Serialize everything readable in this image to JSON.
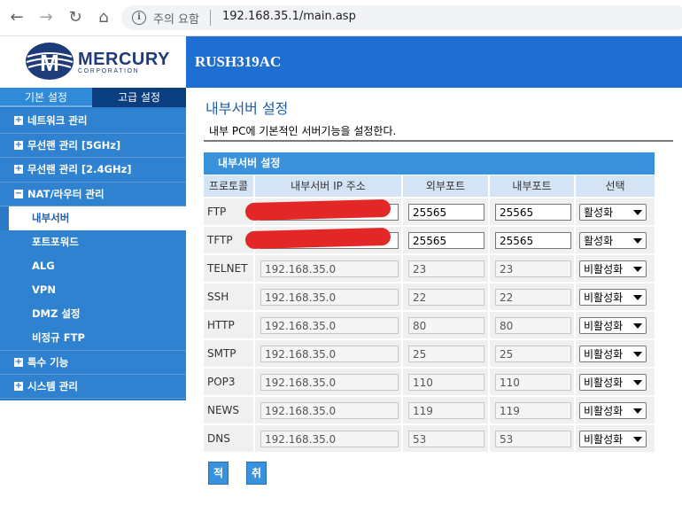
{
  "browser": {
    "security_text": "주의 요함",
    "url": "192.168.35.1/main.asp"
  },
  "header": {
    "logo_name": "MERCURY",
    "logo_sub": "CORPORATION",
    "model": "RUSH319AC",
    "banner_color": "#1f6fd2"
  },
  "sidebar": {
    "tabs": [
      "기본 설정",
      "고급 설정"
    ],
    "items": [
      {
        "label": "네트워크 관리",
        "icon": "plus-icon"
      },
      {
        "label": "무선랜 관리 [5GHz]",
        "icon": "plus-icon"
      },
      {
        "label": "무선랜 관리 [2.4GHz]",
        "icon": "plus-icon"
      },
      {
        "label": "NAT/라우터 관리",
        "icon": "minus-icon"
      }
    ],
    "subitems": [
      "내부서버",
      "포트포워드",
      "ALG",
      "VPN",
      "DMZ 설정",
      "비정규 FTP"
    ],
    "items_after": [
      {
        "label": "특수 기능",
        "icon": "plus-icon"
      },
      {
        "label": "시스템 관리",
        "icon": "plus-icon"
      }
    ]
  },
  "main": {
    "title": "내부서버 설정",
    "description": "내부 PC에 기본적인 서버기능을 설정한다.",
    "table_title": "내부서버 설정",
    "columns": [
      "프로토콜",
      "내부서버 IP 주소",
      "외부포트",
      "내부포트",
      "선택"
    ],
    "rows": [
      {
        "protocol": "FTP",
        "ip": "",
        "ext": "25565",
        "int": "25565",
        "select": "활성화"
      },
      {
        "protocol": "TFTP",
        "ip": "",
        "ext": "25565",
        "int": "25565",
        "select": "활성화"
      },
      {
        "protocol": "TELNET",
        "ip": "192.168.35.0",
        "ext": "23",
        "int": "23",
        "select": "비활성화"
      },
      {
        "protocol": "SSH",
        "ip": "192.168.35.0",
        "ext": "22",
        "int": "22",
        "select": "비활성화"
      },
      {
        "protocol": "HTTP",
        "ip": "192.168.35.0",
        "ext": "80",
        "int": "80",
        "select": "비활성화"
      },
      {
        "protocol": "SMTP",
        "ip": "192.168.35.0",
        "ext": "25",
        "int": "25",
        "select": "비활성화"
      },
      {
        "protocol": "POP3",
        "ip": "192.168.35.0",
        "ext": "110",
        "int": "110",
        "select": "비활성화"
      },
      {
        "protocol": "NEWS",
        "ip": "192.168.35.0",
        "ext": "119",
        "int": "119",
        "select": "비활성화"
      },
      {
        "protocol": "DNS",
        "ip": "192.168.35.0",
        "ext": "53",
        "int": "53",
        "select": "비활성화"
      }
    ],
    "apply_label": "적용",
    "cancel_label": "취소"
  }
}
